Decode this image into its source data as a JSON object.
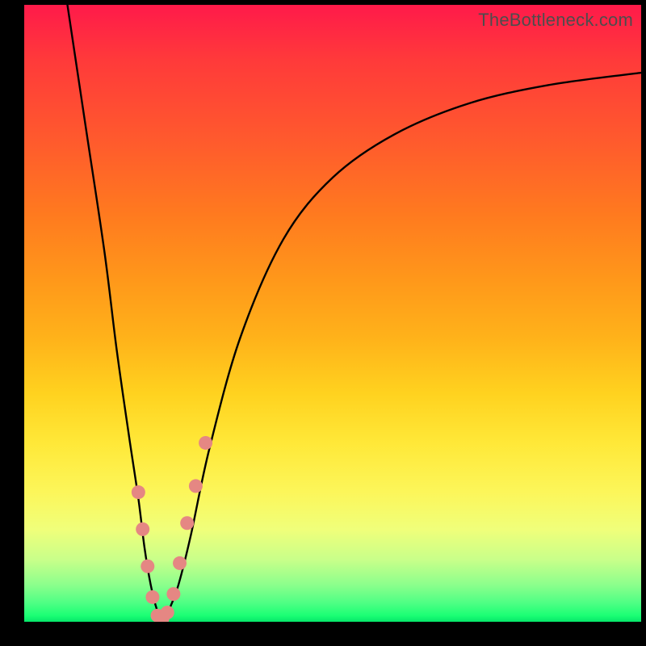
{
  "watermark": "TheBottleneck.com",
  "colors": {
    "frame": "#000000",
    "curve": "#000000",
    "marker_fill": "#e58783",
    "marker_stroke": "#cc6a66"
  },
  "chart_data": {
    "type": "line",
    "title": "",
    "xlabel": "",
    "ylabel": "",
    "xlim": [
      0,
      100
    ],
    "ylim": [
      0,
      100
    ],
    "note": "Axes have no visible tick labels; values below are read as 0–100 percent of the plot area (x left→right, y bottom→top).",
    "series": [
      {
        "name": "curve",
        "x": [
          7,
          10,
          13,
          15,
          17,
          18.5,
          19.5,
          20.5,
          21.5,
          22.5,
          23.5,
          25,
          27,
          30,
          35,
          42,
          50,
          60,
          72,
          85,
          100
        ],
        "y": [
          100,
          80,
          60,
          44,
          30,
          20,
          12,
          6,
          2,
          0,
          2,
          6,
          14,
          28,
          46,
          62,
          72,
          79,
          84,
          87,
          89
        ]
      }
    ],
    "markers": {
      "name": "marker points near valley",
      "x": [
        18.5,
        19.2,
        20.0,
        20.8,
        21.6,
        22.4,
        23.2,
        24.2,
        25.2,
        26.4,
        27.8,
        29.4
      ],
      "y": [
        21,
        15,
        9,
        4,
        1,
        0.5,
        1.5,
        4.5,
        9.5,
        16,
        22,
        29
      ]
    }
  }
}
